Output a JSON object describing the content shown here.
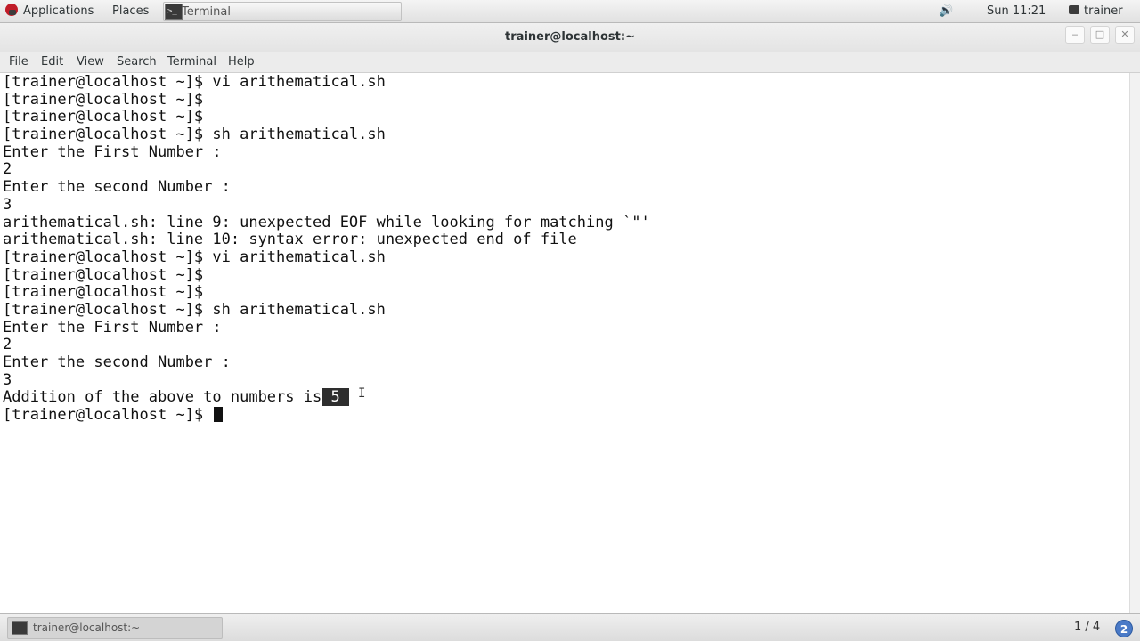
{
  "top_panel": {
    "applications": "Applications",
    "places": "Places",
    "task_label": "Terminal",
    "clock": "Sun 11:21",
    "user": "trainer"
  },
  "window": {
    "title": "trainer@localhost:~",
    "controls": {
      "minimize": "‒",
      "maximize": "□",
      "close": "✕"
    }
  },
  "menu": [
    "File",
    "Edit",
    "View",
    "Search",
    "Terminal",
    "Help"
  ],
  "terminal": {
    "lines": [
      "[trainer@localhost ~]$ vi arithematical.sh",
      "[trainer@localhost ~]$",
      "[trainer@localhost ~]$",
      "[trainer@localhost ~]$ sh arithematical.sh",
      "Enter the First Number :",
      "2",
      "Enter the second Number :",
      "3",
      "arithematical.sh: line 9: unexpected EOF while looking for matching `\"'",
      "arithematical.sh: line 10: syntax error: unexpected end of file",
      "[trainer@localhost ~]$ vi arithematical.sh",
      "[trainer@localhost ~]$",
      "[trainer@localhost ~]$",
      "[trainer@localhost ~]$ sh arithematical.sh",
      "Enter the First Number :",
      "2",
      "Enter the second Number :",
      "3"
    ],
    "result_prefix": "Addition of the above to numbers is",
    "result_value": " 5 ",
    "prompt": "[trainer@localhost ~]$ "
  },
  "bottom_panel": {
    "task_label": "trainer@localhost:~",
    "workspace": "1 / 4",
    "workspace_icon": "2"
  }
}
